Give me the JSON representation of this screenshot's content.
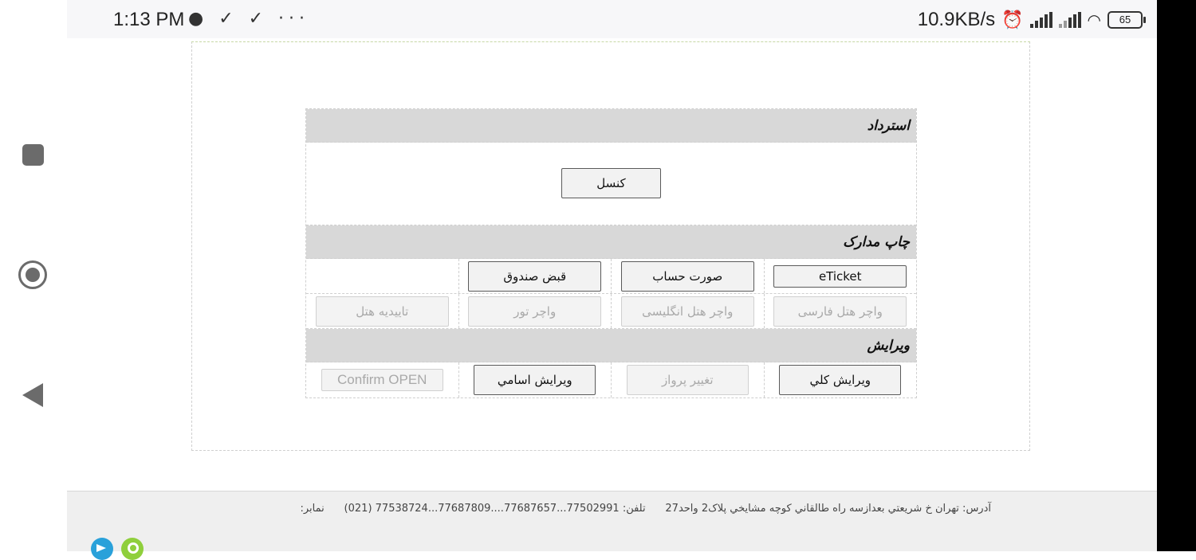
{
  "status_bar": {
    "time": "1:13 PM",
    "left_icons": "● ✓ ✓ ···",
    "net_speed": "10.9KB/s",
    "battery": "65"
  },
  "sections": {
    "refund": {
      "title": "استرداد",
      "cancel_label": "کنسل"
    },
    "print_docs": {
      "title": "چاپ مدارک",
      "row1": [
        "eTicket",
        "صورت حساب",
        "قبض صندوق"
      ],
      "row2": [
        "واچر هتل فارسی",
        "واچر هتل انگلیسی",
        "واچر تور",
        "تاییدیه هتل"
      ]
    },
    "edit": {
      "title": "ویرایش",
      "items": [
        "ویرایش کلي",
        "تغيير پرواز",
        "ويرايش اسامي",
        "Confirm OPEN"
      ]
    }
  },
  "footer": {
    "address": "آدرس: تهران خ شريعتي بعدازسه راه طالقاني كوچه مشايخي پلاک2 واحد27",
    "phone": "تلفن: 77502991...77687657....77687809...77538724 (021)",
    "fax": "نمابر:"
  },
  "colors": {
    "section_header_bg": "#d8d8d8",
    "telegram": "#2aa1da",
    "map": "#8fcf3c"
  }
}
